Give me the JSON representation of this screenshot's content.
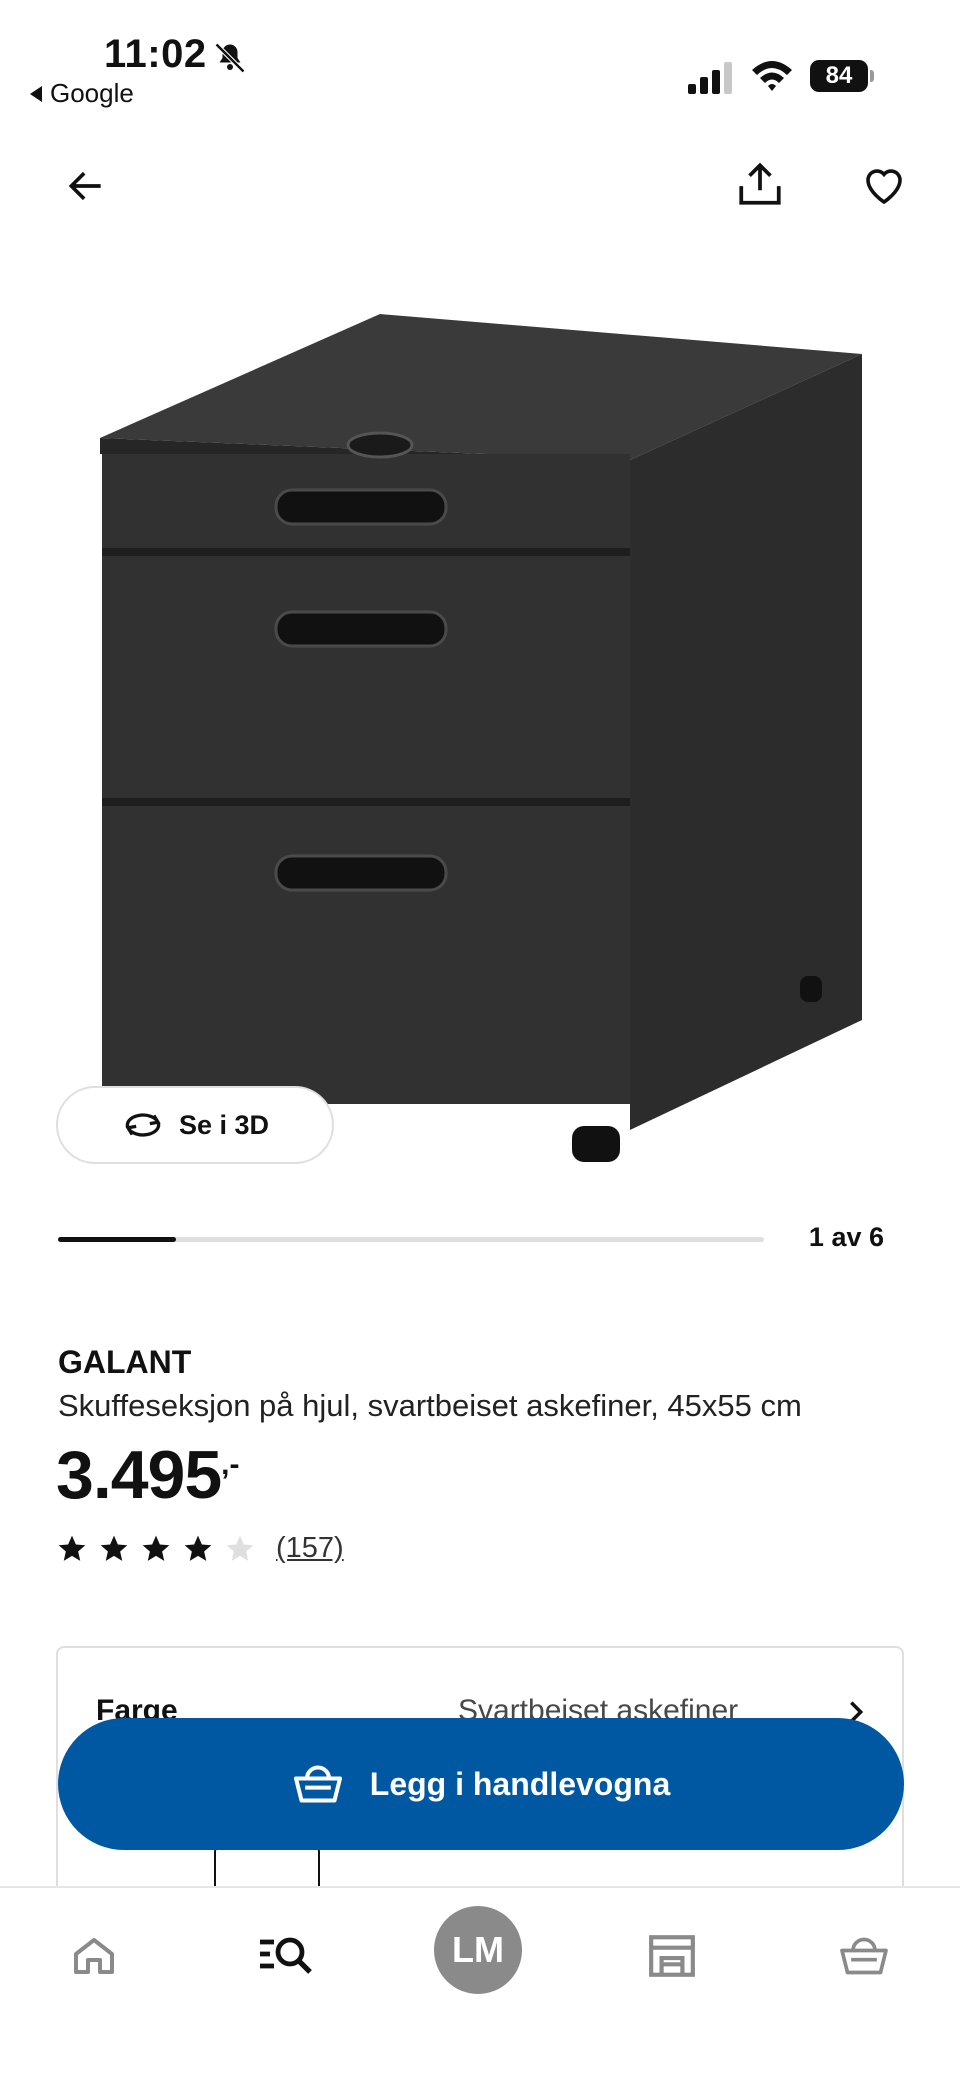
{
  "status_bar": {
    "time": "11:02",
    "back_app": "Google",
    "battery": "84"
  },
  "nav": {
    "back_icon": "arrow-left-icon",
    "share_icon": "share-icon",
    "favorite_icon": "heart-icon"
  },
  "gallery": {
    "see_3d_label": "Se i 3D",
    "position_label": "1 av 6",
    "progress_fraction": 0.1667
  },
  "product": {
    "brand": "GALANT",
    "description": "Skuffeseksjon på hjul, svartbeiset askefiner, 45x55 cm",
    "price": "3.495",
    "price_suffix": ",-",
    "rating": 4,
    "rating_max": 5,
    "review_count": "(157)"
  },
  "color_option": {
    "label": "Farge",
    "value": "Svartbeiset askefiner"
  },
  "cart_button": {
    "label": "Legg i handlevogna"
  },
  "tab_bar": {
    "profile_initials": "LM",
    "items": [
      "home-icon",
      "search-icon",
      "profile-avatar",
      "store-icon",
      "cart-icon"
    ]
  },
  "colors": {
    "accent": "#0058a3",
    "text": "#111111",
    "divider": "#dfdfdf",
    "product_dark": "#2b2b2b"
  }
}
